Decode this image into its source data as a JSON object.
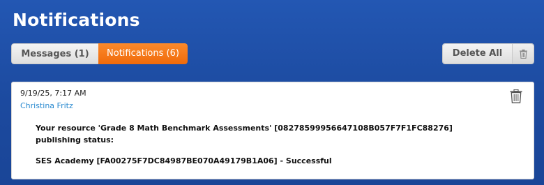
{
  "page": {
    "title": "Notifications"
  },
  "tabs": [
    {
      "label": "Messages (1)",
      "active": false
    },
    {
      "label": "Notifications (6)",
      "active": true
    }
  ],
  "toolbar": {
    "delete_all_label": "Delete All",
    "delete_icon": "trash-icon"
  },
  "notification": {
    "timestamp": "9/19/25, 7:17 AM",
    "author": "Christina Fritz",
    "message_line1": "Your resource 'Grade 8 Math Benchmark Assessments' [08278599956647108B057F7F1FC88276]",
    "message_line2": "publishing status:",
    "result": "SES Academy [FA00275F7DC84987BE070A49179B1A06] - Successful",
    "delete_icon": "trash-icon"
  },
  "colors": {
    "background": "#1b4aa2",
    "active_tab": "#f47a1a",
    "link": "#2a8ad0"
  }
}
